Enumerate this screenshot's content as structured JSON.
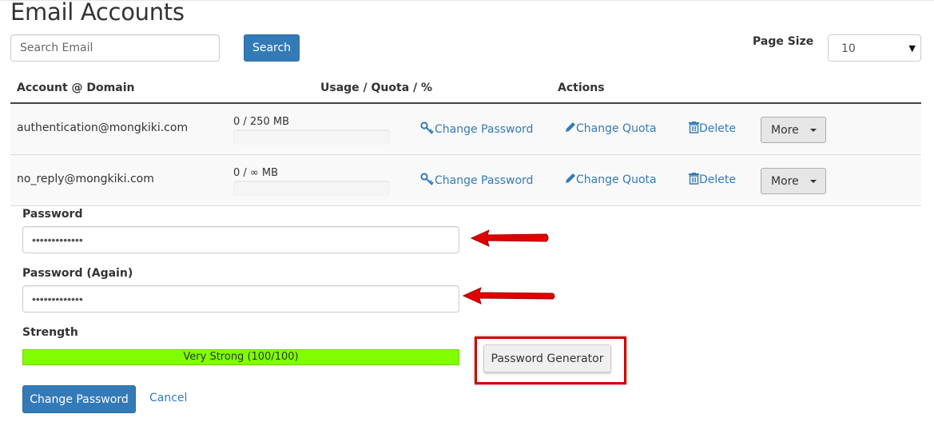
{
  "page": {
    "title": "Email Accounts"
  },
  "search": {
    "placeholder": "Search Email",
    "button_label": "Search"
  },
  "page_size": {
    "label": "Page Size",
    "selected": "10"
  },
  "table": {
    "headers": [
      "Account @ Domain",
      "Usage / Quota / %",
      "Actions"
    ],
    "rows": [
      {
        "email": "authentication@mongkiki.com",
        "usage": "0 / 250 MB",
        "usage_percent": 0,
        "change_password": "Change Password",
        "change_quota": "Change Quota",
        "delete": "Delete",
        "more": "More"
      },
      {
        "email": "no_reply@mongkiki.com",
        "usage": "0 / ∞ MB",
        "usage_percent": 0,
        "change_password": "Change Password",
        "change_quota": "Change Quota",
        "delete": "Delete",
        "more": "More"
      }
    ]
  },
  "form": {
    "password_label": "Password",
    "password_value": "•••••••••••••",
    "password_again_label": "Password (Again)",
    "password_again_value": "•••••••••••••",
    "strength_label": "Strength",
    "strength_text": "Very Strong (100/100)",
    "strength_percent": 100,
    "generator_button": "Password Generator",
    "submit_button": "Change Password",
    "cancel_link": "Cancel"
  },
  "colors": {
    "primary": "#337ab7",
    "strength_fill": "#7fff00",
    "annotation_red": "#e00000"
  },
  "icons": {
    "change_password": "key-icon",
    "change_quota": "pencil-icon",
    "delete": "trash-icon",
    "more": "caret-down-icon",
    "select": "caret-down-icon"
  }
}
